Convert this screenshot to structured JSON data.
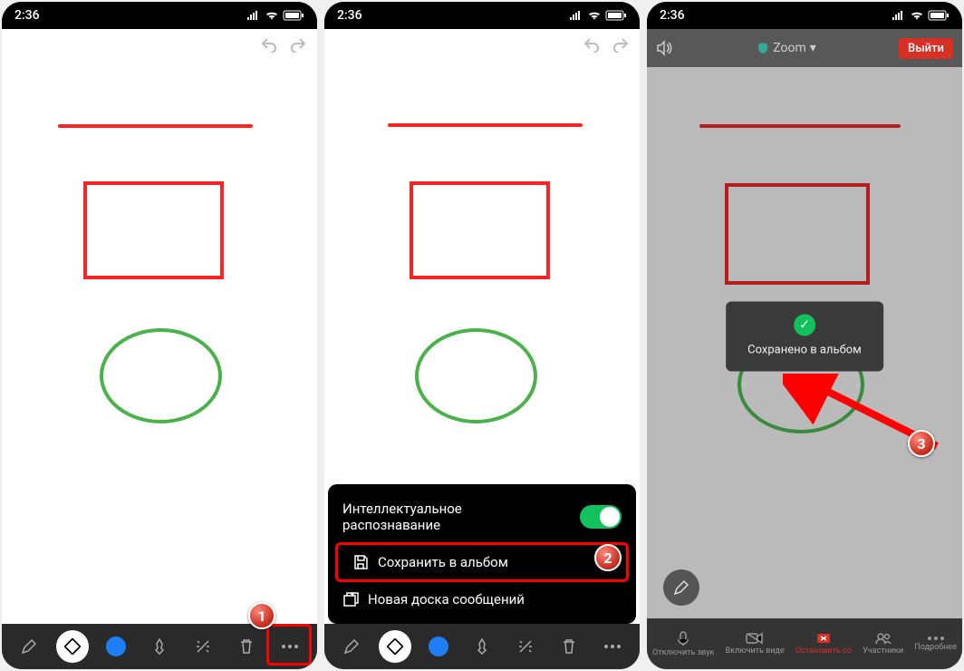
{
  "status": {
    "time": "2:36"
  },
  "bottombar": {
    "mute": "Отключить звук",
    "video": "Включить виде",
    "stop": "Остановить со",
    "participants": "Участники",
    "more": "Подробнее"
  },
  "popup": {
    "smart_recognition": "Интеллектуальное распознавание",
    "save_to_album": "Сохранить в альбом",
    "new_board": "Новая доска сообщений"
  },
  "meeting": {
    "title": "Zoom",
    "exit": "Выйти"
  },
  "toast": {
    "saved": "Сохранено в альбом"
  },
  "badges": {
    "b1": "1",
    "b2": "2",
    "b3": "3"
  }
}
